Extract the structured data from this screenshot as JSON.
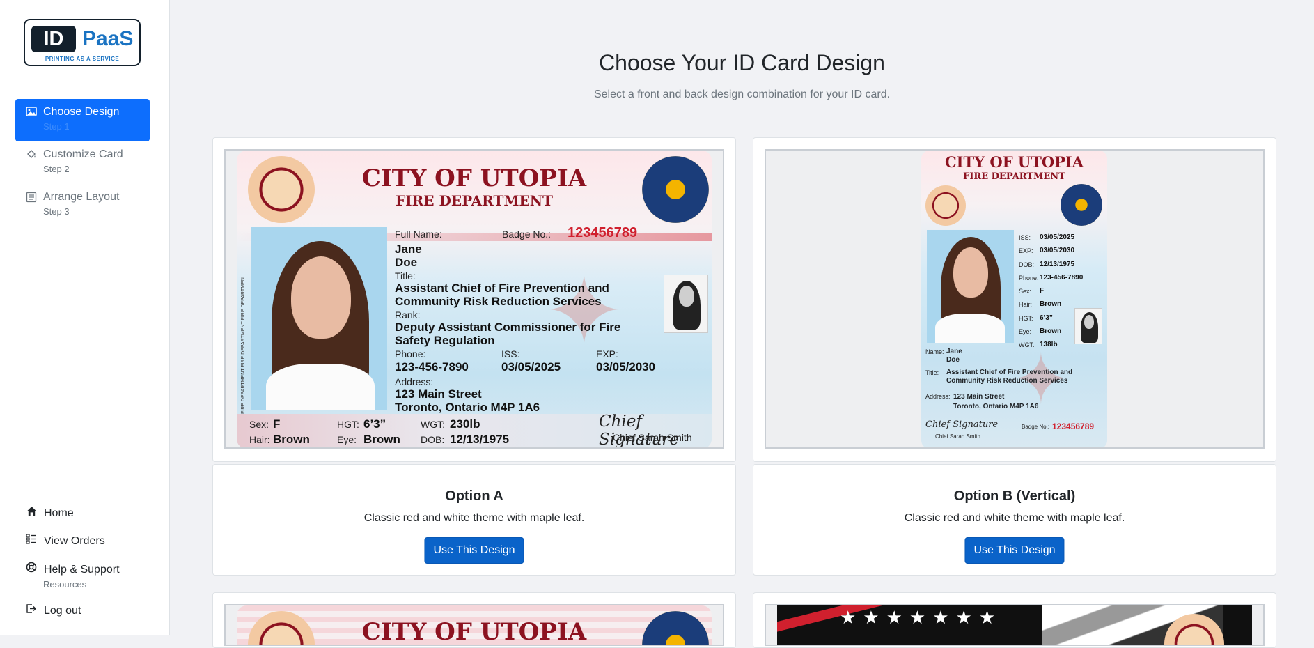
{
  "brand": {
    "id": "ID",
    "paas": "PaaS",
    "tagline": "PRINTING AS A SERVICE"
  },
  "steps": [
    {
      "label": "Choose Design",
      "step": "Step 1"
    },
    {
      "label": "Customize Card",
      "step": "Step 2"
    },
    {
      "label": "Arrange Layout",
      "step": "Step 3"
    }
  ],
  "bottom_nav": {
    "home": "Home",
    "orders": "View Orders",
    "help": "Help & Support",
    "help_sub": "Resources",
    "logout": "Log out"
  },
  "page": {
    "title": "Choose Your ID Card Design",
    "subtitle": "Select a front and back design combination for your ID card."
  },
  "cards": [
    {
      "title": "Option A",
      "desc": "Classic red and white theme with maple leaf.",
      "button": "Use This Design"
    },
    {
      "title": "Option B (Vertical)",
      "desc": "Classic red and white theme with maple leaf.",
      "button": "Use This Design"
    }
  ],
  "card_a": {
    "city": "CITY OF UTOPIA",
    "dept": "FIRE DEPARTMENT",
    "fullname_label": "Full Name:",
    "badge_label": "Badge No.:",
    "badge": "123456789",
    "first": "Jane",
    "last": "Doe",
    "title_label": "Title:",
    "title1": "Assistant Chief of Fire Prevention and",
    "title2": "Community Risk Reduction Services",
    "rank_label": "Rank:",
    "rank1": "Deputy Assistant Commissioner for Fire",
    "rank2": "Safety Regulation",
    "phone_label": "Phone:",
    "phone": "123-456-7890",
    "iss_label": "ISS:",
    "iss": "03/05/2025",
    "exp_label": "EXP:",
    "exp": "03/05/2030",
    "addr_label": "Address:",
    "addr1": "123 Main Street",
    "addr2": "Toronto, Ontario M4P 1A6",
    "sex_label": "Sex:",
    "sex": "F",
    "hgt_label": "HGT:",
    "hgt": "6’3”",
    "wgt_label": "WGT:",
    "wgt": "230lb",
    "hair_label": "Hair:",
    "hair": "Brown",
    "eye_label": "Eye:",
    "eye": "Brown",
    "dob_label": "DOB:",
    "dob": "12/13/1975",
    "signature": "Chief Signature",
    "chief": "Chief Sarah Smith",
    "strip": "FIRE DEPARTMENT FIRE DEPARTMENT FIRE DEPARTMEN"
  },
  "card_b": {
    "city": "CITY OF UTOPIA",
    "dept": "FIRE DEPARTMENT",
    "iss_label": "ISS:",
    "iss": "03/05/2025",
    "exp_label": "EXP:",
    "exp": "03/05/2030",
    "dob_label": "DOB:",
    "dob": "12/13/1975",
    "phone_label": "Phone:",
    "phone": "123-456-7890",
    "sex_label": "Sex:",
    "sex": "F",
    "hair_label": "Hair:",
    "hair": "Brown",
    "hgt_label": "HGT:",
    "hgt": "6’3”",
    "eye_label": "Eye:",
    "eye": "Brown",
    "wgt_label": "WGT:",
    "wgt": "138lb",
    "name_label": "Name:",
    "first": "Jane",
    "last": "Doe",
    "title_label": "Title:",
    "title1": "Assistant Chief of Fire Prevention and",
    "title2": "Community Risk Reduction Services",
    "addr_label": "Address:",
    "addr1": "123 Main Street",
    "addr2": "Toronto, Ontario M4P 1A6",
    "signature": "Chief Signature",
    "chief": "Chief Sarah Smith",
    "badge_label": "Badge No.:",
    "badge": "123456789"
  },
  "card_c": {
    "city": "CITY OF UTOPIA"
  },
  "colors": {
    "primary": "#0d6efd",
    "button": "#0a63c9",
    "brand": "#1a73c2",
    "dark": "#13202c",
    "card_red": "#8c1220"
  }
}
